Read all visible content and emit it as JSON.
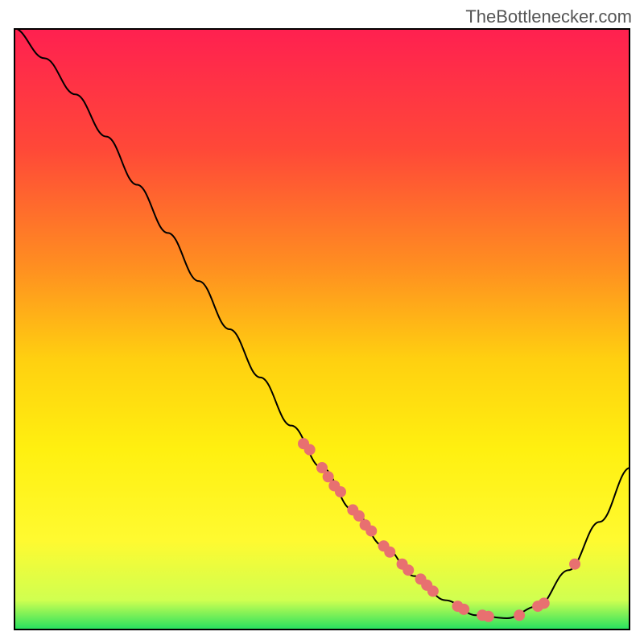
{
  "watermark": "TheBottlenecker.com",
  "chart_data": {
    "type": "line",
    "title": "",
    "xlabel": "",
    "ylabel": "",
    "xlim": [
      0,
      100
    ],
    "ylim": [
      0,
      100
    ],
    "curve_points": [
      {
        "x": 0,
        "y": 100
      },
      {
        "x": 5,
        "y": 95
      },
      {
        "x": 10,
        "y": 89
      },
      {
        "x": 15,
        "y": 82
      },
      {
        "x": 20,
        "y": 74
      },
      {
        "x": 25,
        "y": 66
      },
      {
        "x": 30,
        "y": 58
      },
      {
        "x": 35,
        "y": 50
      },
      {
        "x": 40,
        "y": 42
      },
      {
        "x": 45,
        "y": 34
      },
      {
        "x": 50,
        "y": 27
      },
      {
        "x": 55,
        "y": 20
      },
      {
        "x": 60,
        "y": 14
      },
      {
        "x": 65,
        "y": 9
      },
      {
        "x": 70,
        "y": 5
      },
      {
        "x": 75,
        "y": 2.5
      },
      {
        "x": 80,
        "y": 2
      },
      {
        "x": 85,
        "y": 4
      },
      {
        "x": 90,
        "y": 10
      },
      {
        "x": 95,
        "y": 18
      },
      {
        "x": 100,
        "y": 27
      }
    ],
    "scatter_points": [
      {
        "x": 47,
        "y": 31
      },
      {
        "x": 48,
        "y": 30
      },
      {
        "x": 50,
        "y": 27
      },
      {
        "x": 51,
        "y": 25.5
      },
      {
        "x": 52,
        "y": 24
      },
      {
        "x": 53,
        "y": 23
      },
      {
        "x": 55,
        "y": 20
      },
      {
        "x": 56,
        "y": 19
      },
      {
        "x": 57,
        "y": 17.5
      },
      {
        "x": 58,
        "y": 16.5
      },
      {
        "x": 60,
        "y": 14
      },
      {
        "x": 61,
        "y": 13
      },
      {
        "x": 63,
        "y": 11
      },
      {
        "x": 64,
        "y": 10
      },
      {
        "x": 66,
        "y": 8.5
      },
      {
        "x": 67,
        "y": 7.5
      },
      {
        "x": 68,
        "y": 6.5
      },
      {
        "x": 72,
        "y": 4
      },
      {
        "x": 73,
        "y": 3.5
      },
      {
        "x": 76,
        "y": 2.5
      },
      {
        "x": 77,
        "y": 2.3
      },
      {
        "x": 82,
        "y": 2.5
      },
      {
        "x": 85,
        "y": 4
      },
      {
        "x": 86,
        "y": 4.5
      },
      {
        "x": 91,
        "y": 11
      }
    ],
    "gradient_stops": [
      {
        "offset": 0,
        "color": "#ff2050"
      },
      {
        "offset": 20,
        "color": "#ff4838"
      },
      {
        "offset": 40,
        "color": "#ff9020"
      },
      {
        "offset": 55,
        "color": "#ffd010"
      },
      {
        "offset": 70,
        "color": "#fff010"
      },
      {
        "offset": 85,
        "color": "#fffa30"
      },
      {
        "offset": 95,
        "color": "#d0ff50"
      },
      {
        "offset": 100,
        "color": "#20e060"
      }
    ],
    "scatter_color": "#e87070",
    "curve_color": "#000000"
  }
}
